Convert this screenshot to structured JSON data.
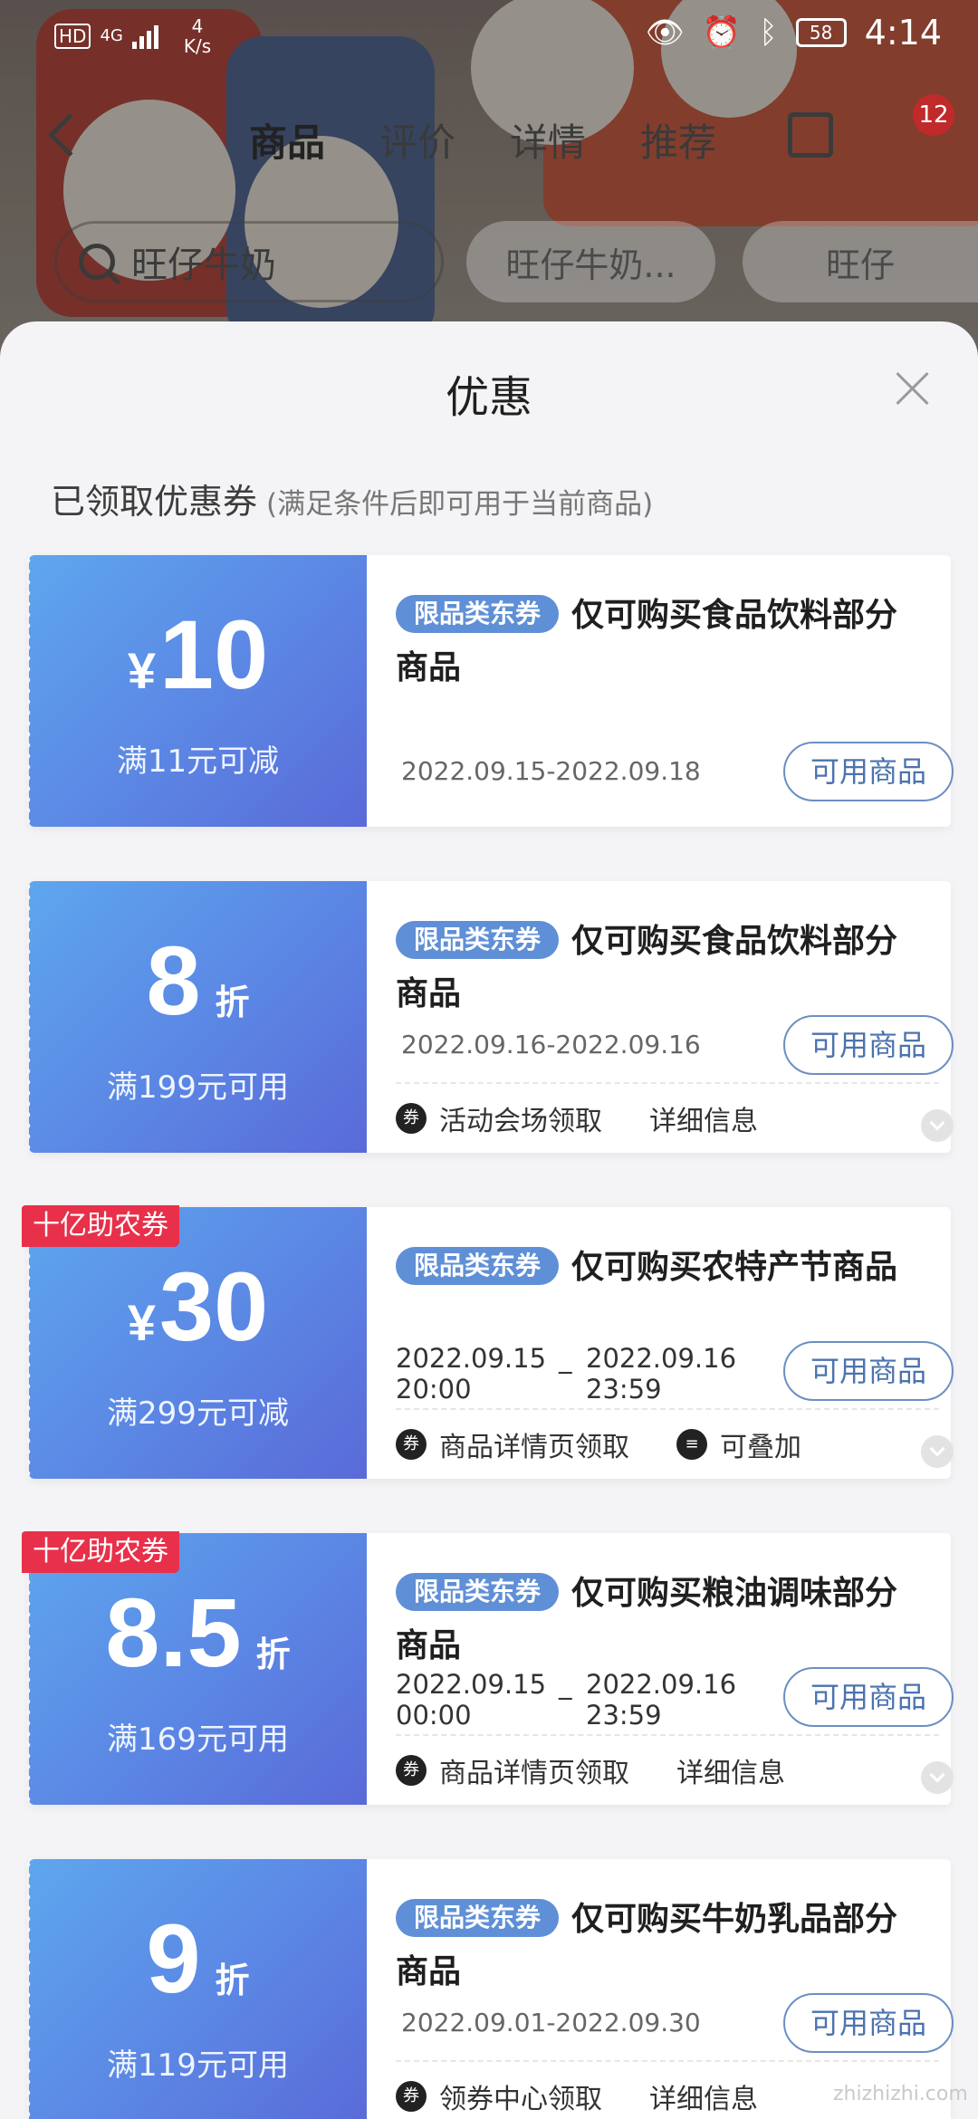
{
  "status_bar": {
    "hd": "HD",
    "signal": "4G",
    "net_speed_value": "4",
    "net_speed_unit": "K/s",
    "battery": "58",
    "time": "4:14"
  },
  "nav": {
    "tabs": [
      {
        "label": "商品"
      },
      {
        "label": "评价"
      },
      {
        "label": "详情"
      },
      {
        "label": "推荐"
      }
    ],
    "cart_badge": "12"
  },
  "search": {
    "value": "旺仔牛奶",
    "chips": [
      "旺仔牛奶...",
      "旺仔"
    ]
  },
  "sheet": {
    "title": "优惠",
    "section_title": "已领取优惠券",
    "section_note": "(满足条件后即可用于当前商品)"
  },
  "coupons": [
    {
      "symbol": "¥",
      "amount": "10",
      "unit": "",
      "condition": "满11元可减",
      "badge": "限品类东券",
      "title": "仅可购买食品饮料部分商品",
      "date": "2022.09.15-2022.09.18",
      "button": "可用商品"
    },
    {
      "symbol": "",
      "amount": "8",
      "unit": "折",
      "condition": "满199元可用",
      "badge": "限品类东券",
      "title": "仅可购买食品饮料部分商品",
      "date": "2022.09.16-2022.09.16",
      "button": "可用商品",
      "foot": [
        "活动会场领取",
        "详细信息"
      ]
    },
    {
      "tag": "十亿助农券",
      "symbol": "¥",
      "amount": "30",
      "unit": "",
      "condition": "满299元可减",
      "badge": "限品类东券",
      "title": "仅可购买农特产节商品",
      "date_start": "2022.09.15",
      "date_start_time": "20:00",
      "date_sep": "_",
      "date_end": "2022.09.16",
      "date_end_time": "23:59",
      "button": "可用商品",
      "foot": [
        "商品详情页领取",
        "可叠加"
      ]
    },
    {
      "tag": "十亿助农券",
      "symbol": "",
      "amount": "8.5",
      "unit": "折",
      "condition": "满169元可用",
      "badge": "限品类东券",
      "title": "仅可购买粮油调味部分商品",
      "date_start": "2022.09.15",
      "date_start_time": "00:00",
      "date_sep": "_",
      "date_end": "2022.09.16",
      "date_end_time": "23:59",
      "button": "可用商品",
      "foot": [
        "商品详情页领取",
        "详细信息"
      ]
    },
    {
      "symbol": "",
      "amount": "9",
      "unit": "折",
      "condition": "满119元可用",
      "badge": "限品类东券",
      "title": "仅可购买牛奶乳品部分商品",
      "date": "2022.09.01-2022.09.30",
      "button": "可用商品",
      "foot": [
        "领券中心领取",
        "详细信息"
      ]
    }
  ],
  "watermark": "zhizhizhi.com",
  "colors": {
    "coupon_gradient_start": "#5ea6ee",
    "coupon_gradient_end": "#5a6ad8",
    "tag_red": "#e8304a",
    "badge_blue": "#5f8fd6",
    "button_blue": "#4b73ae"
  }
}
